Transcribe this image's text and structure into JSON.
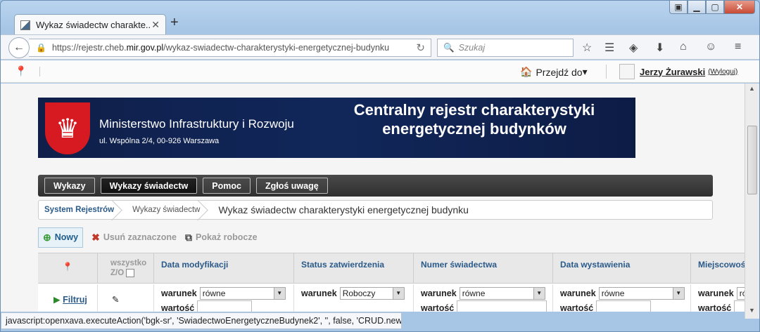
{
  "browser": {
    "tab_title": "Wykaz świadectw charakte...",
    "url_prefix": "https://rejestr.cheb.",
    "url_domain": "mir.gov.pl",
    "url_path": "/wykaz-swiadectw-charakterystyki-energetycznej-budynku",
    "search_placeholder": "Szukaj",
    "status_text": "javascript:openxava.executeAction('bgk-sr', 'SwiadectwoEnergetyczneBudynek2', '', false, 'CRUD.new')"
  },
  "bookbar": {
    "goto": "Przejdź do",
    "user_name": "Jerzy Żurawski",
    "logout": "(Wyloguj)"
  },
  "banner": {
    "ministry": "Ministerstwo Infrastruktury i Rozwoju",
    "address": "ul. Wspólna 2/4, 00-926 Warszawa",
    "title": "Centralny rejestr charakterystyki energetycznej budynków"
  },
  "menu": [
    "Wykazy",
    "Wykazy świadectw",
    "Pomoc",
    "Zgłoś uwagę"
  ],
  "breadcrumb": [
    "System Rejestrów",
    "Wykazy świadectw",
    "Wykaz świadectw charakterystyki energetycznej budynku"
  ],
  "actions": {
    "new": "Nowy",
    "delete": "Usuń zaznaczone",
    "show_drafts": "Pokaż robocze"
  },
  "grid": {
    "all_label": "wszystko",
    "zo_label": "Z/O",
    "filter": "Filtruj",
    "cond_label": "warunek",
    "value_label": "wartość",
    "columns": [
      {
        "title": "Data modyfikacji",
        "cond": "równe"
      },
      {
        "title": "Status zatwierdzenia",
        "cond": "Roboczy"
      },
      {
        "title": "Numer świadectwa",
        "cond": "równe"
      },
      {
        "title": "Data wystawienia",
        "cond": "równe"
      },
      {
        "title": "Miejscowość",
        "cond": "ró"
      }
    ]
  }
}
